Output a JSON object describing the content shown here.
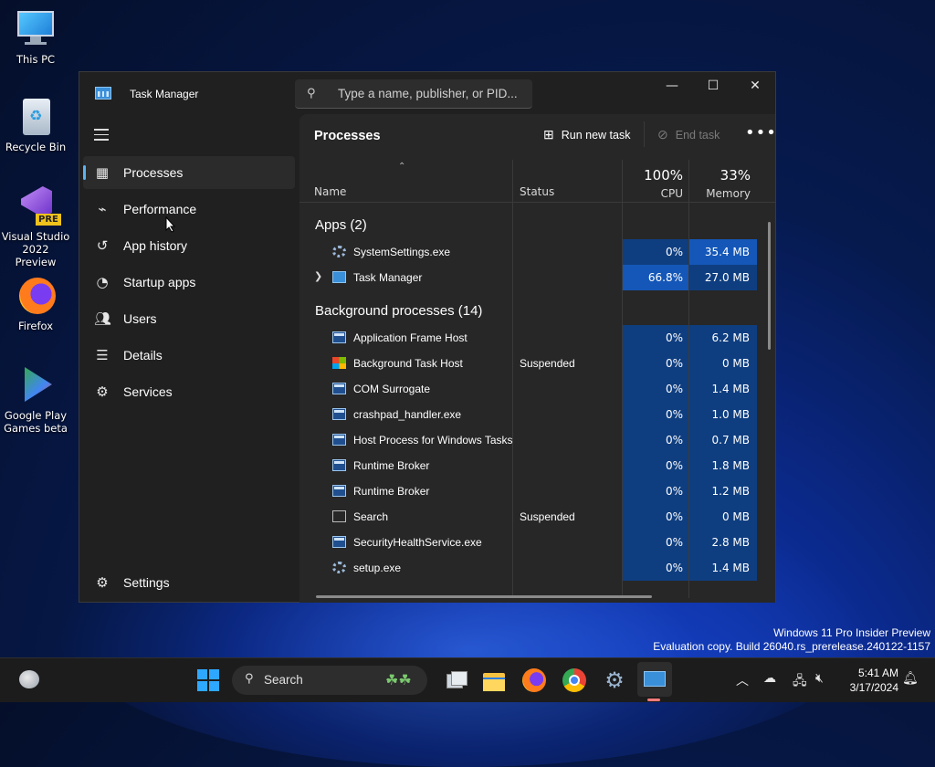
{
  "desktop": {
    "icons": [
      {
        "label": "This PC",
        "icon": "monitor-icon"
      },
      {
        "label": "Recycle Bin",
        "icon": "recycle-bin-icon"
      },
      {
        "label": "Visual Studio 2022 Preview",
        "icon": "visual-studio-icon",
        "badge": "PRE"
      },
      {
        "label": "Firefox",
        "icon": "firefox-icon"
      },
      {
        "label": "Google Play Games beta",
        "icon": "google-play-games-icon"
      }
    ],
    "watermark": {
      "line1": "Windows 11 Pro Insider Preview",
      "line2": "Evaluation copy. Build 26040.rs_prerelease.240122-1157"
    }
  },
  "window": {
    "title": "Task Manager",
    "search_placeholder": "Type a name, publisher, or PID...",
    "controls": {
      "minimize": "—",
      "maximize": "☐",
      "close": "✕"
    }
  },
  "sidebar": {
    "items": [
      {
        "label": "Processes",
        "icon": "processes-icon",
        "active": true
      },
      {
        "label": "Performance",
        "icon": "performance-icon"
      },
      {
        "label": "App history",
        "icon": "app-history-icon"
      },
      {
        "label": "Startup apps",
        "icon": "startup-apps-icon"
      },
      {
        "label": "Users",
        "icon": "users-icon"
      },
      {
        "label": "Details",
        "icon": "details-icon"
      },
      {
        "label": "Services",
        "icon": "services-icon"
      }
    ],
    "settings_label": "Settings"
  },
  "toolbar": {
    "page_title": "Processes",
    "run_new_task": "Run new task",
    "end_task": "End task",
    "more": "•••"
  },
  "table": {
    "columns": {
      "name": "Name",
      "status": "Status",
      "cpu_pct": "100%",
      "cpu_label": "CPU",
      "mem_pct": "33%",
      "mem_label": "Memory"
    },
    "groups": {
      "apps": "Apps (2)",
      "background": "Background processes (14)"
    },
    "apps": [
      {
        "name": "SystemSettings.exe",
        "status": "",
        "cpu": "0%",
        "mem": "35.4 MB"
      },
      {
        "name": "Task Manager",
        "status": "",
        "cpu": "66.8%",
        "mem": "27.0 MB"
      }
    ],
    "background": [
      {
        "name": "Application Frame Host",
        "status": "",
        "cpu": "0%",
        "mem": "6.2 MB"
      },
      {
        "name": "Background Task Host",
        "status": "Suspended",
        "cpu": "0%",
        "mem": "0 MB"
      },
      {
        "name": "COM Surrogate",
        "status": "",
        "cpu": "0%",
        "mem": "1.4 MB"
      },
      {
        "name": "crashpad_handler.exe",
        "status": "",
        "cpu": "0%",
        "mem": "1.0 MB"
      },
      {
        "name": "Host Process for Windows Tasks",
        "status": "",
        "cpu": "0%",
        "mem": "0.7 MB"
      },
      {
        "name": "Runtime Broker",
        "status": "",
        "cpu": "0%",
        "mem": "1.8 MB"
      },
      {
        "name": "Runtime Broker",
        "status": "",
        "cpu": "0%",
        "mem": "1.2 MB"
      },
      {
        "name": "Search",
        "status": "Suspended",
        "cpu": "0%",
        "mem": "0 MB"
      },
      {
        "name": "SecurityHealthService.exe",
        "status": "",
        "cpu": "0%",
        "mem": "2.8 MB"
      },
      {
        "name": "setup.exe",
        "status": "",
        "cpu": "0%",
        "mem": "1.4 MB"
      }
    ]
  },
  "taskbar": {
    "search_label": "Search",
    "clock_time": "5:41 AM",
    "clock_date": "3/17/2024"
  }
}
